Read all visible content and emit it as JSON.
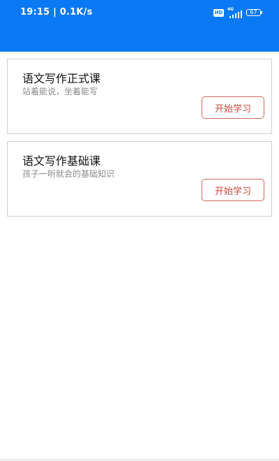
{
  "status_bar": {
    "time": "19:15 | 0.1K/s",
    "hd_label": "HD",
    "network_label": "4G",
    "battery_level": "67"
  },
  "colors": {
    "header_bg": "#0b79f3",
    "button_text": "#c8463b",
    "button_border": "#d2665c"
  },
  "courses": [
    {
      "title": "语文写作正式课",
      "subtitle": "站着能说，坐着能写",
      "button_label": "开始学习"
    },
    {
      "title": "语文写作基础课",
      "subtitle": "孩子一听就会的基础知识",
      "button_label": "开始学习"
    }
  ]
}
